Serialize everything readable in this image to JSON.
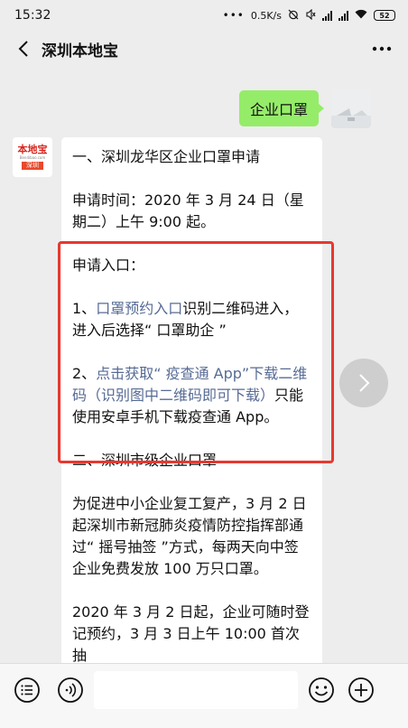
{
  "status": {
    "time": "15:32",
    "net_speed": "0.5K/s",
    "battery": "52"
  },
  "header": {
    "title": "深圳本地宝"
  },
  "chat": {
    "outgoing": {
      "text": "企业口罩"
    },
    "incoming_avatar": {
      "logo_text": "本地宝",
      "logo_domain": "Bendibao.com",
      "logo_city": "深圳"
    },
    "incoming": {
      "line1": "一、深圳龙华区企业口罩申请",
      "line2": "申请时间：2020 年 3 月 24 日（星期二）上午 9:00 起。",
      "entry_title": "申请入口：",
      "item1_prefix": "1、",
      "item1_link": "口罩预约入口",
      "item1_rest": "识别二维码进入，进入后选择“ 口罩助企 ”",
      "item2_prefix": "2、",
      "item2_link": "点击获取“ 疫查通 App”下载二维码（识别图中二维码即可下载）",
      "item2_rest": "只能使用安卓手机下载疫查通 App。",
      "section2_title": "二、深圳市级企业口罩",
      "section2_p1": "为促进中小企业复工复产，3 月 2 日起深圳市新冠肺炎疫情防控指挥部通过“ 摇号抽签 ”方式，每两天向中签企业免费发放 100 万只口罩。",
      "section2_p2": "2020 年 3 月 2 日起，企业可随时登记预约，3 月 3 日上午 10:00 首次抽"
    }
  },
  "colors": {
    "outgoing_bubble": "#95ec69",
    "link": "#576b95",
    "highlight_box": "#e8382f",
    "background": "#ededed"
  }
}
